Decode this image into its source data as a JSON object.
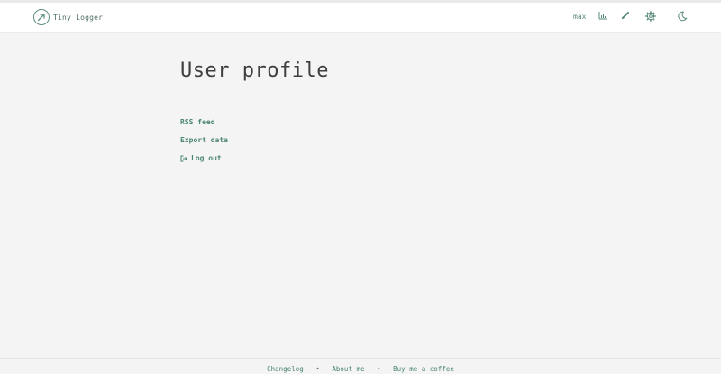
{
  "header": {
    "brand": "Tiny Logger",
    "username": "max",
    "icons": [
      "logo-icon",
      "stats-icon",
      "edit-icon",
      "settings-icon",
      "moon-icon"
    ]
  },
  "main": {
    "title": "User profile",
    "links": {
      "rss": "RSS feed",
      "export": "Export data",
      "logout": "Log out"
    }
  },
  "footer": {
    "changelog": "Changelog",
    "about": "About me",
    "coffee": "Buy me a coffee",
    "separator": "•"
  },
  "colors": {
    "accent": "#4a8572",
    "background": "#f4f4f4",
    "header_bg": "#ffffff"
  }
}
